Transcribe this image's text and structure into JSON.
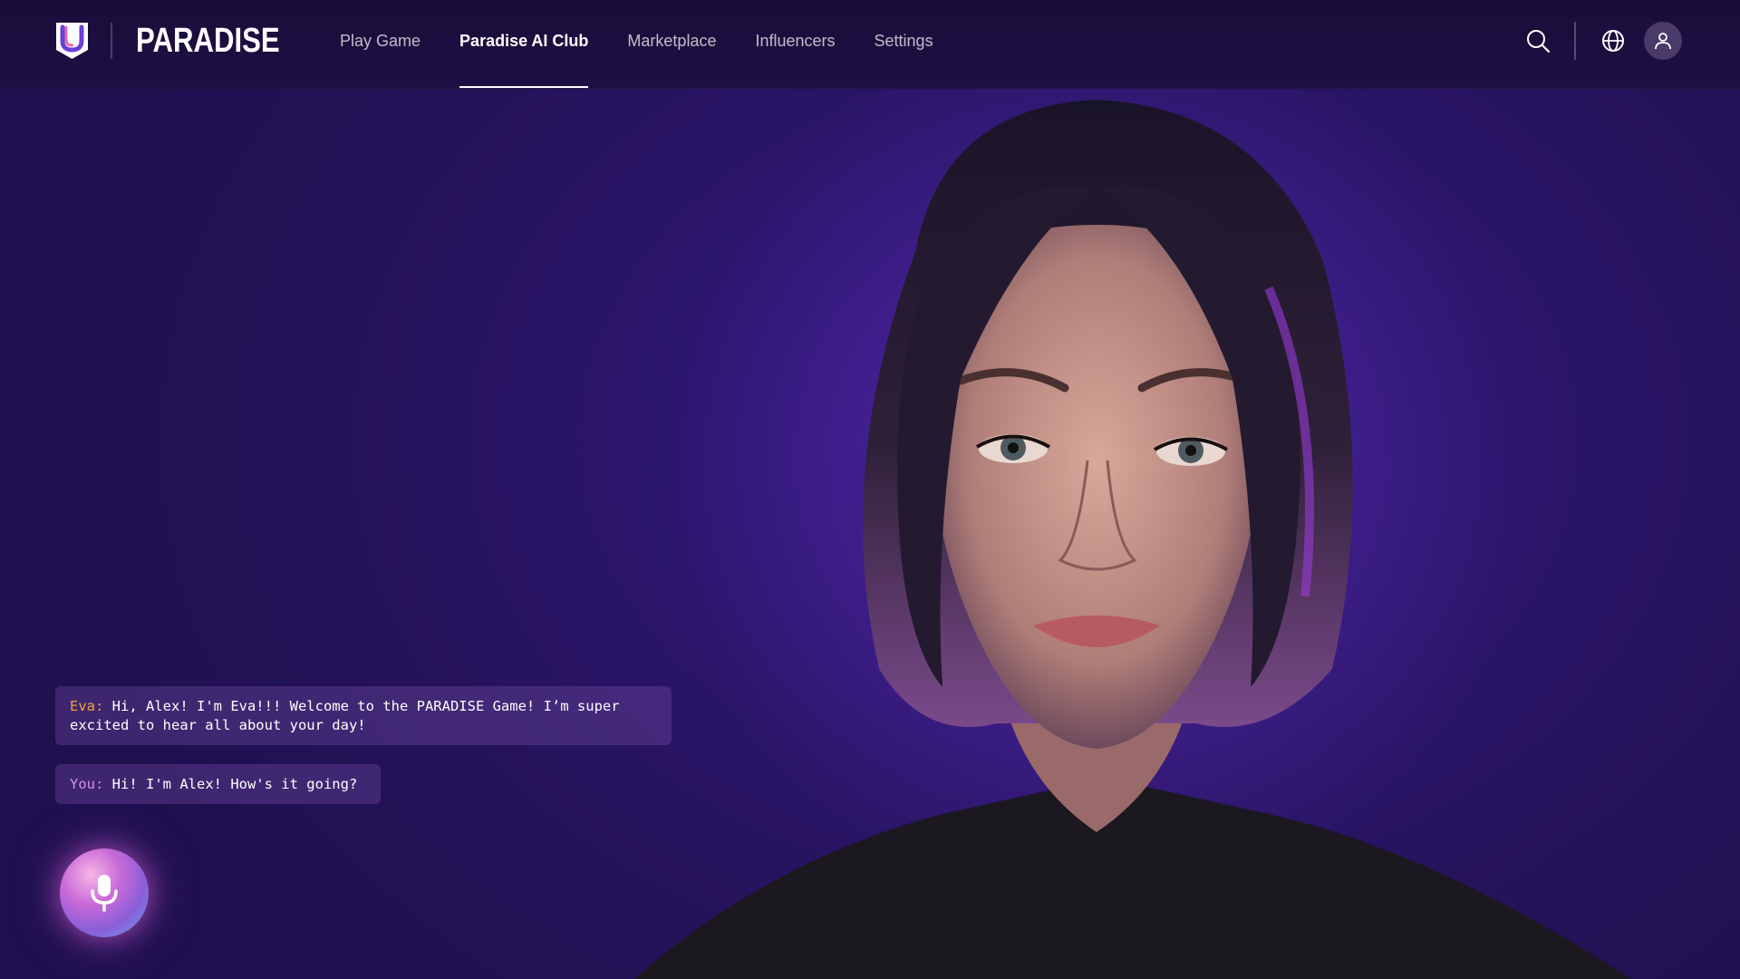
{
  "app": {
    "brand": "PARADISE",
    "logo_icon": "shield-u-logo-icon"
  },
  "nav": {
    "items": [
      {
        "label": "Play Game",
        "active": false
      },
      {
        "label": "Paradise AI Club",
        "active": true
      },
      {
        "label": "Marketplace",
        "active": false
      },
      {
        "label": "Influencers",
        "active": false
      },
      {
        "label": "Settings",
        "active": false
      }
    ]
  },
  "header_actions": {
    "search_icon": "search-icon",
    "language_icon": "globe-icon",
    "profile_icon": "user-icon"
  },
  "chat": {
    "messages": [
      {
        "speaker": "Eva:",
        "text": "Hi, Alex! I'm Eva!!! Welcome to the PARADISE Game! I’m super excited to hear all about your day!"
      },
      {
        "speaker": "You:",
        "text": "Hi! I'm Alex! How's it going?"
      }
    ]
  },
  "mic": {
    "icon": "microphone-icon"
  },
  "colors": {
    "background": "#2c1670",
    "topbar": "#1a0d3a",
    "speaker_eva": "#f2a23a",
    "speaker_you": "#d790e8"
  }
}
